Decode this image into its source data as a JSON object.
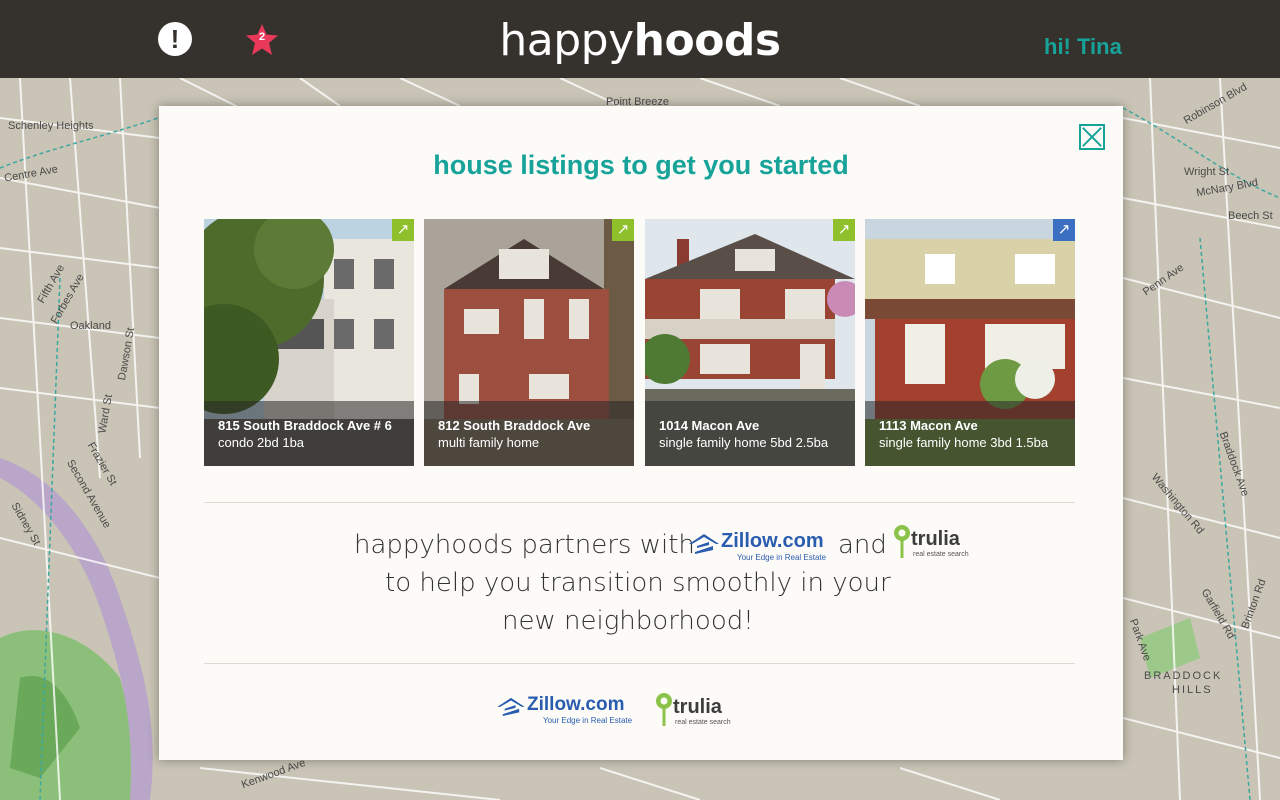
{
  "header": {
    "alert_icon": "exclamation-icon",
    "favorites_icon": "star-icon",
    "favorites_count": "2",
    "logo_light": "happy",
    "logo_bold": "hoods",
    "greeting": "hi! Tina"
  },
  "map": {
    "labels": [
      "Schenley Heights",
      "Oakland",
      "Centre Ave",
      "Fifth Ave",
      "Forbes Ave",
      "Point Breeze",
      "BRADDOCK",
      "HILLS",
      "Penn Ave",
      "Wright St",
      "McNary Blvd",
      "Beech St",
      "Robinson Blvd",
      "Dawson St",
      "Ward St",
      "Frazier St",
      "Second Avenue",
      "Sidney St",
      "Kenwood Ave",
      "Braddock Ave",
      "Washington Rd",
      "Garfield Rd",
      "Park Ave",
      "Brinton Rd"
    ]
  },
  "modal": {
    "title": "house listings to get you started",
    "close_icon": "close-icon",
    "listings": [
      {
        "address": "815 South Braddock Ave # 6",
        "description": "condo 2bd 1ba"
      },
      {
        "address": "812 South Braddock Ave",
        "description": "multi family home"
      },
      {
        "address": "1014 Macon Ave",
        "description": "single family home 5bd  2.5ba"
      },
      {
        "address": "1113 Macon Ave",
        "description": "single family home 3bd  1.5ba"
      }
    ],
    "partner_line1": "happyhoods partners with",
    "partner_and": "and",
    "partner_line2": "to help you transition smoothly in your",
    "partner_line3": "new neighborhood!",
    "zillow_name": "Zillow.com",
    "zillow_tagline": "Your Edge in Real Estate",
    "trulia_name": "trulia",
    "trulia_tagline": "real estate search"
  },
  "colors": {
    "teal": "#17a39a",
    "header_bg": "#35312d",
    "card_link_green": "#8fbf2a",
    "card_link_blue": "#3b6fc2"
  }
}
